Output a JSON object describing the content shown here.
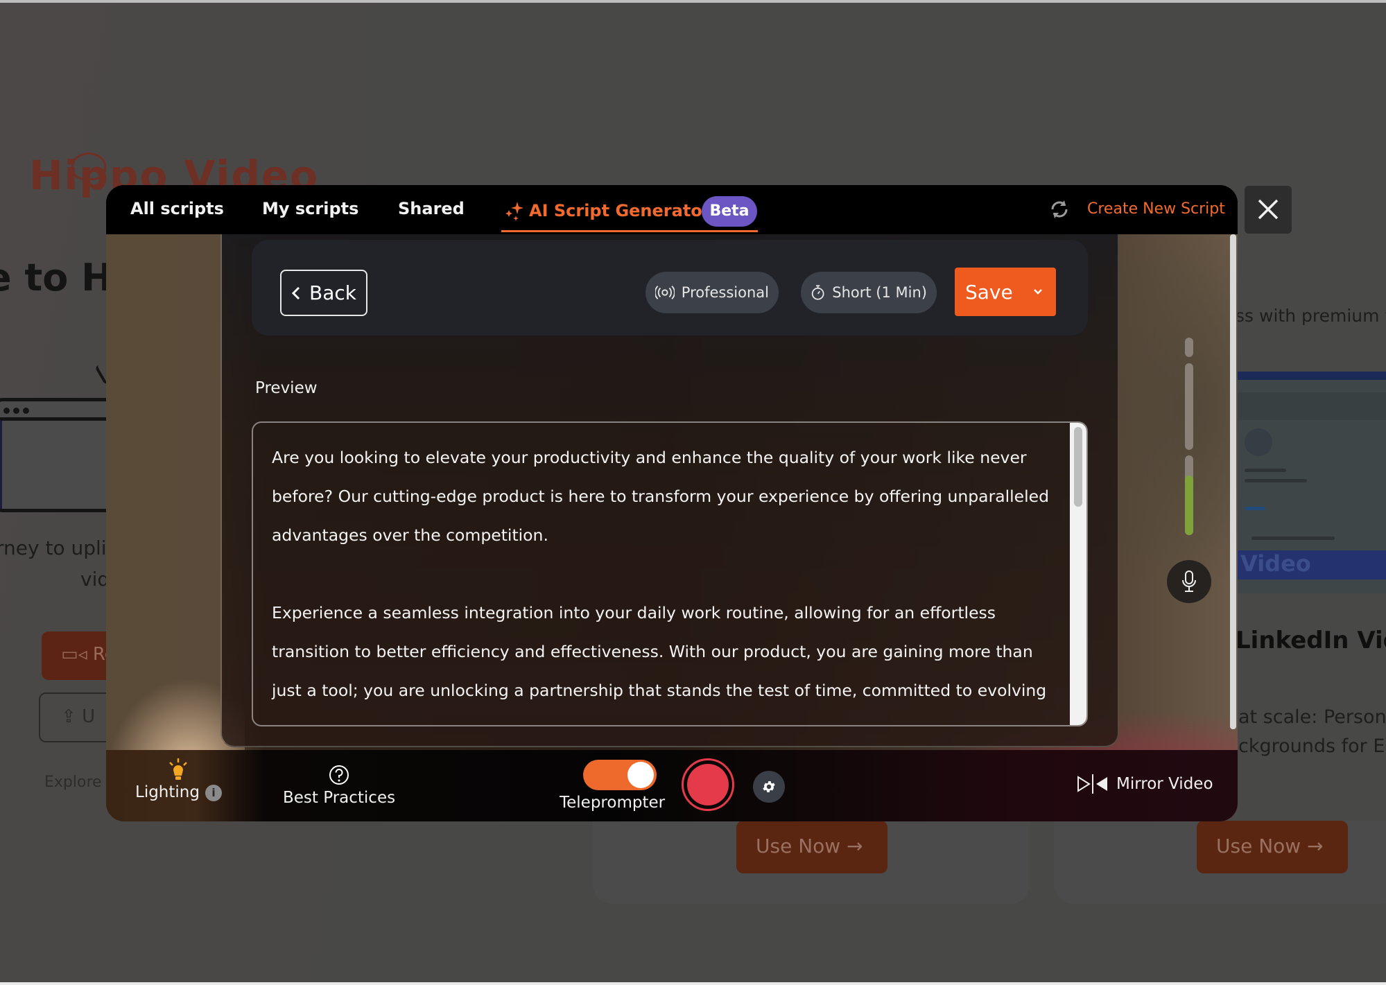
{
  "background_page": {
    "logo_text": "Hippo Video",
    "heading_fragment": "e to Hi",
    "description_line1": "rney to uplif",
    "description_line2": "vid",
    "record_button_fragment": "Re",
    "upload_button_fragment": "U",
    "explore_fragment": "Explore H",
    "right_tagline_fragment": "ss with premium vi",
    "card_image_label": "Video",
    "card_title_fragment": "LinkedIn Vid",
    "card_sub_line1": "at scale: Persona",
    "card_sub_line2": "ckgrounds for En",
    "use_now_buttons": [
      {
        "label": "Use Now",
        "icon": "arrow-right-icon"
      },
      {
        "label": "Use Now",
        "icon": "arrow-right-icon"
      }
    ]
  },
  "modal": {
    "tabs": [
      {
        "label": "All scripts",
        "active": false
      },
      {
        "label": "My scripts",
        "active": false
      },
      {
        "label": "Shared",
        "active": false
      },
      {
        "label": "AI Script Generator",
        "active": true,
        "icon": "sparkle-icon",
        "badge": "Beta"
      }
    ],
    "create_new_script": {
      "label": "Create New Script",
      "icon": "refresh-icon"
    },
    "close_icon": "close-icon",
    "controls": {
      "back_label": "Back",
      "tone": {
        "label": "Professional",
        "icon": "broadcast-icon"
      },
      "length": {
        "label": "Short (1 Min)",
        "icon": "stopwatch-icon"
      },
      "save_label": "Save"
    },
    "preview": {
      "label": "Preview",
      "paragraphs": [
        "Are you looking to elevate your productivity and enhance the quality of your work like never before? Our cutting-edge product is here to transform your experience by offering unparalleled advantages over the competition.",
        "Experience a seamless integration into your daily work routine, allowing for an effortless transition to better efficiency and effectiveness. With our product, you are gaining more than just a tool; you are unlocking a partnership that stands the test of time, committed to evolving"
      ]
    },
    "audio_level_fraction": 0.18,
    "bottom_bar": {
      "lighting_label": "Lighting",
      "lighting_info_icon": "i",
      "best_practices_label": "Best Practices",
      "teleprompter_label": "Teleprompter",
      "teleprompter_on": true,
      "mirror_video_label": "Mirror Video"
    }
  },
  "colors": {
    "accent_orange": "#f26a2e",
    "save_orange": "#ef5a1e",
    "beta_purple": "#6b56c4",
    "record_red": "#e43a49",
    "audio_green": "#7fa33a"
  }
}
